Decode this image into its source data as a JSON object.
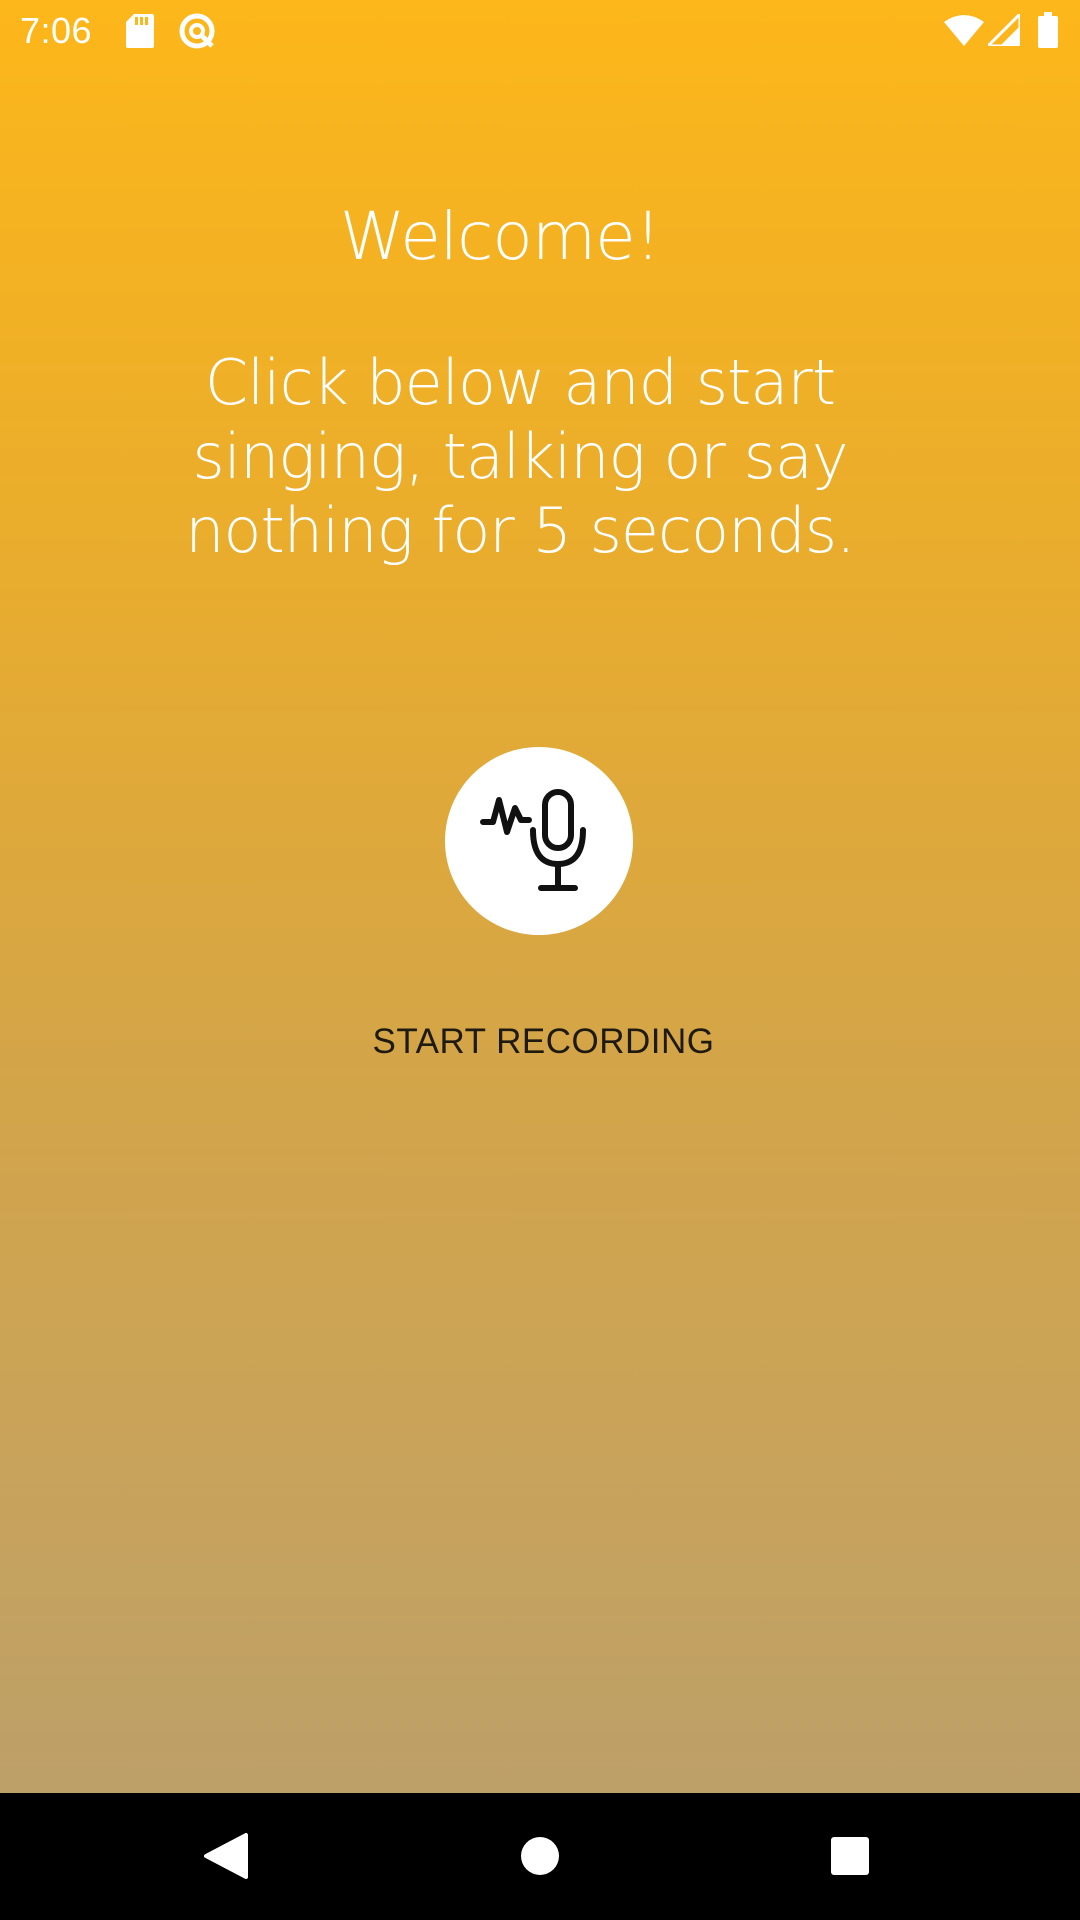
{
  "status_bar": {
    "time": "7:06",
    "icons": [
      "sd-card-icon",
      "sync-icon",
      "wifi-icon",
      "cell-signal-icon",
      "battery-icon"
    ]
  },
  "main": {
    "welcome_title": "Welcome!",
    "instructions": "Click below and start singing, talking or say nothing for 5 seconds.",
    "record_button_icon": "microphone-waveform-icon",
    "record_label": "START RECORDING"
  },
  "nav_bar": {
    "buttons": [
      "back-icon",
      "home-icon",
      "recents-icon"
    ]
  },
  "colors": {
    "gradient_top": "#fdb71a",
    "gradient_bottom": "#b89f6e",
    "text_light": "#ffffff",
    "text_dark": "#1e1a12",
    "nav_background": "#000000"
  }
}
